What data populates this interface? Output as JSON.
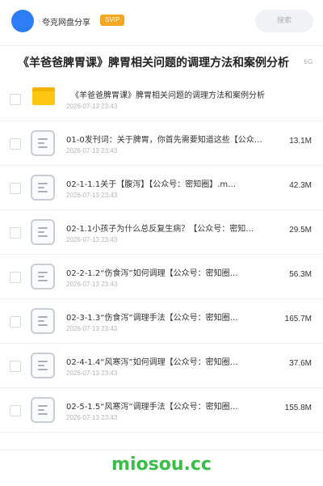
{
  "header": {
    "site_name": "夸克网盘分享",
    "badge": "SVIP",
    "search_placeholder": "搜索",
    "accent_color": "#2d7df6",
    "badge_color": "#f5a623"
  },
  "title": {
    "text": "《羊爸爸脾胃课》脾胃相关问题的调理方法和案例分析",
    "size": "6G"
  },
  "files": [
    {
      "type": "folder",
      "name": "《羊爸爸脾胃课》脾胃相关问题的调理方法和案例分析",
      "date": "2026-07-13 23:43",
      "size": ""
    },
    {
      "type": "file",
      "name": "01-0发刊词：关于脾胃，你首先需要知道这些【公众…",
      "date": "2026-07-13 23:43",
      "size": "13.1M"
    },
    {
      "type": "file",
      "name": "02-1-1.1关于【腹泻】【公众号：密知圈】.m…",
      "date": "2026-07-13 23:43",
      "size": "42.3M"
    },
    {
      "type": "file",
      "name": "02-1.1小孩子为什么总反复生病？【公众号：密知…",
      "date": "2026-07-13 23:43",
      "size": "29.5M"
    },
    {
      "type": "file",
      "name": "02-2-1.2“伤食泻”如何调理【公众号：密知圈…",
      "date": "2026-07-13 23:43",
      "size": "56.3M"
    },
    {
      "type": "file",
      "name": "02-3-1.3“伤食泻”调理手法【公众号：密知圈…",
      "date": "2026-07-13 23:43",
      "size": "165.7M"
    },
    {
      "type": "file",
      "name": "02-4-1.4“风寒泻”如何调理【公众号：密知圈…",
      "date": "2026-07-13 23:43",
      "size": "37.6M"
    },
    {
      "type": "file",
      "name": "02-5-1.5“风寒泻”调理手法【公众号：密知圈…",
      "date": "2026-07-13 23:43",
      "size": "155.8M"
    }
  ],
  "footer": {
    "watermark": "miosou.cc",
    "watermark_color": "#3bbd4a"
  }
}
